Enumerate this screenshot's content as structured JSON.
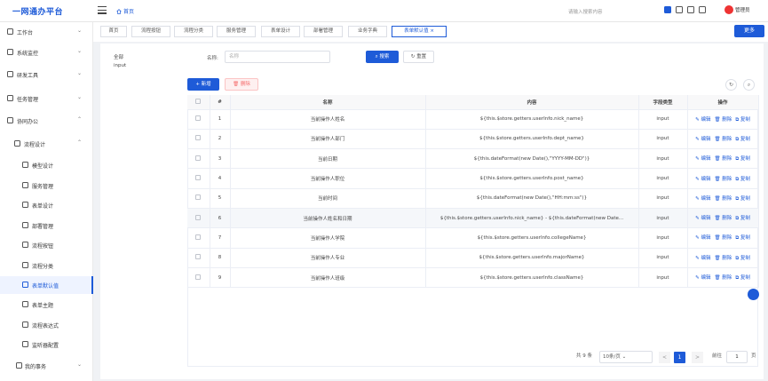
{
  "header": {
    "brand": "一网通办平台",
    "home": "首页",
    "search_placeholder": "请输入搜索内容",
    "user": "管理员"
  },
  "sidebar": {
    "items": [
      {
        "label": "工作台",
        "arrow": "⌄"
      },
      {
        "label": "系统监控",
        "arrow": "⌄"
      },
      {
        "label": "研发工具",
        "arrow": "⌄"
      },
      {
        "label": "任务管理",
        "arrow": "⌄"
      },
      {
        "label": "协同办公",
        "arrow": "⌃"
      },
      {
        "label": "流程设计",
        "arrow": "⌃"
      },
      {
        "label": "模型设计"
      },
      {
        "label": "服务管理"
      },
      {
        "label": "表单设计"
      },
      {
        "label": "部署管理"
      },
      {
        "label": "流程按钮"
      },
      {
        "label": "流程分类"
      },
      {
        "label": "表单默认值"
      },
      {
        "label": "表单主题"
      },
      {
        "label": "流程表达式"
      },
      {
        "label": "监听器配置"
      },
      {
        "label": "我的事务",
        "arrow": "⌄"
      }
    ]
  },
  "tabs": {
    "items": [
      "首页",
      "流程按钮",
      "流程分类",
      "服务管理",
      "表单设计",
      "部署管理",
      "业务字典",
      "表单默认值"
    ],
    "close": "×",
    "more": "更多"
  },
  "tree": {
    "all": "全部",
    "input": "input"
  },
  "search": {
    "name_label": "名称:",
    "name_placeholder": "名称",
    "search_btn": "搜索",
    "reset_btn": "重置"
  },
  "toolbar": {
    "add": "新增",
    "delete": "删除"
  },
  "table": {
    "headers": [
      "",
      "#",
      "名称",
      "内容",
      "字段类型",
      "操作"
    ],
    "rows": [
      {
        "no": "1",
        "name": "当前操作人姓名",
        "content": "${this.$store.getters.userInfo.nick_name}",
        "type": "input"
      },
      {
        "no": "2",
        "name": "当前操作人部门",
        "content": "${this.$store.getters.userInfo.dept_name}",
        "type": "input"
      },
      {
        "no": "3",
        "name": "当前日期",
        "content": "${this.dateFormat(new Date(),\"YYYY-MM-DD\")}",
        "type": "input"
      },
      {
        "no": "4",
        "name": "当前操作人职位",
        "content": "${this.$store.getters.userInfo.post_name}",
        "type": "input"
      },
      {
        "no": "5",
        "name": "当前时间",
        "content": "${this.dateFormat(new Date(),\"HH:mm:ss\")}",
        "type": "input"
      },
      {
        "no": "6",
        "name": "当前操作人姓名和日期",
        "content": "${this.$store.getters.userInfo.nick_name} - ${this.dateFormat(new Date...",
        "type": "input"
      },
      {
        "no": "7",
        "name": "当前操作人学院",
        "content": "${this.$store.getters.userInfo.collegeName}",
        "type": "input"
      },
      {
        "no": "8",
        "name": "当前操作人专业",
        "content": "${this.$store.getters.userInfo.majorName}",
        "type": "input"
      },
      {
        "no": "9",
        "name": "当前操作人班级",
        "content": "${this.$store.getters.userInfo.className}",
        "type": "input"
      }
    ],
    "ops": {
      "edit": "编辑",
      "delete": "删除",
      "copy": "复制"
    }
  },
  "pagination": {
    "total": "共 9 条",
    "size": "10条/页",
    "prev": "<",
    "current": "1",
    "next": ">",
    "goto": "前往",
    "goto_value": "1",
    "page_unit": "页"
  },
  "colors": {
    "accent": "#1e5bd8",
    "danger": "#f56c6c"
  }
}
